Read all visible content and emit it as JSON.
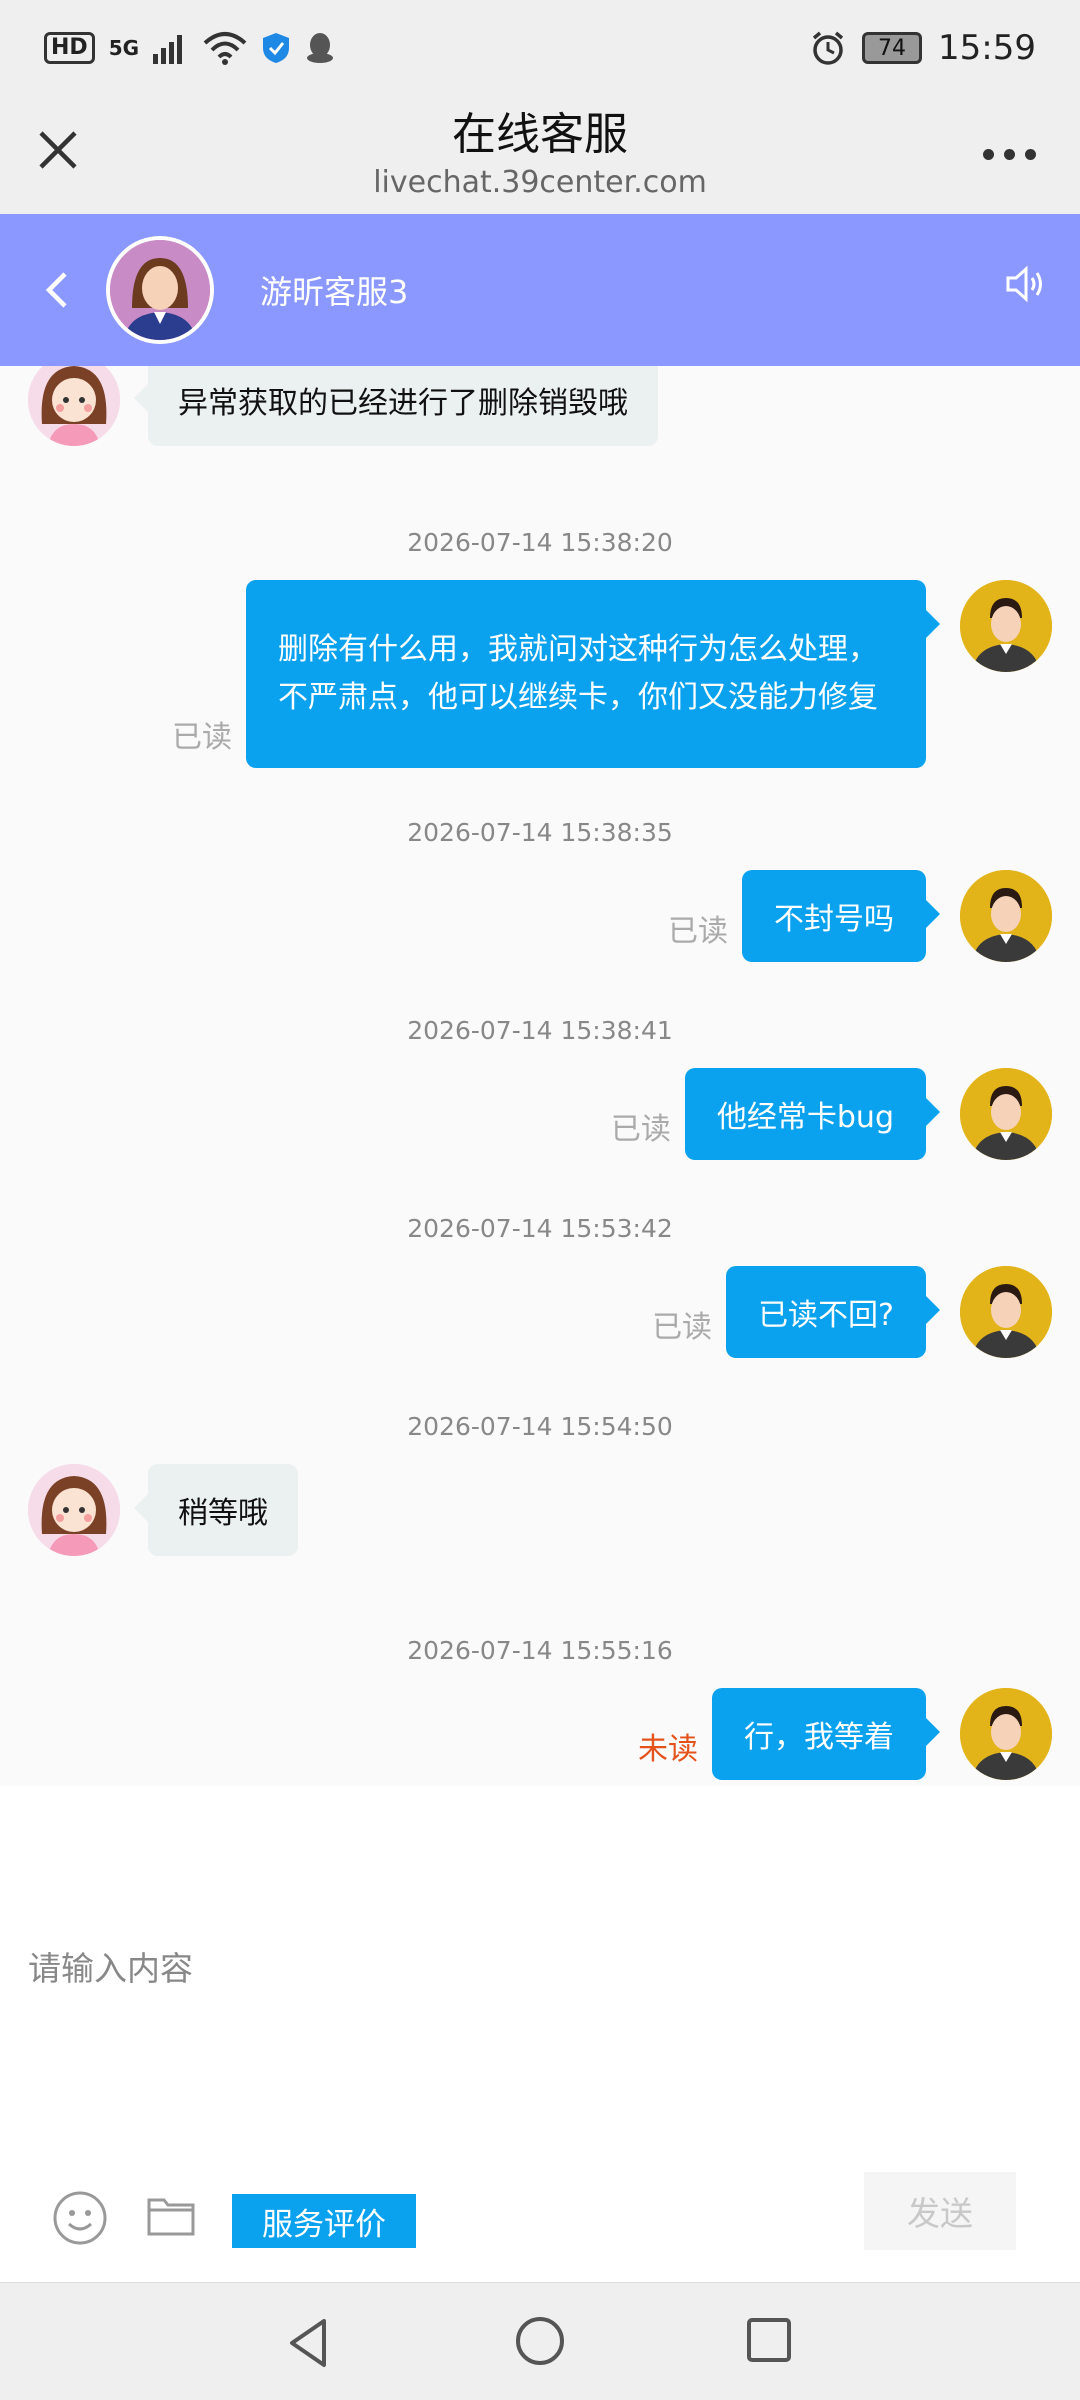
{
  "status_bar": {
    "hd": "HD",
    "network": "5G",
    "battery": "74",
    "time": "15:59"
  },
  "header": {
    "title": "在线客服",
    "url": "livechat.39center.com"
  },
  "agent": {
    "name": "游昕客服3"
  },
  "messages": [
    {
      "side": "left",
      "text": "异常获取的已经进行了删除销毁哦"
    },
    {
      "timestamp": "2026-07-14 15:38:20",
      "side": "right",
      "text": "删除有什么用，我就问对这种行为怎么处理，不严肃点，他可以继续卡，你们又没能力修复",
      "status": "已读"
    },
    {
      "timestamp": "2026-07-14 15:38:35",
      "side": "right",
      "text": "不封号吗",
      "status": "已读"
    },
    {
      "timestamp": "2026-07-14 15:38:41",
      "side": "right",
      "text": "他经常卡bug",
      "status": "已读"
    },
    {
      "timestamp": "2026-07-14 15:53:42",
      "side": "right",
      "text": "已读不回?",
      "status": "已读"
    },
    {
      "timestamp": "2026-07-14 15:54:50",
      "side": "left",
      "text": "稍等哦"
    },
    {
      "timestamp": "2026-07-14 15:55:16",
      "side": "right",
      "text": "行，我等着",
      "status": "未读"
    }
  ],
  "input": {
    "placeholder": "请输入内容"
  },
  "toolbar": {
    "rate_label": "服务评价",
    "send_label": "发送"
  },
  "colors": {
    "accent": "#0aa2ee",
    "agent_bar": "#8b98ff",
    "unread": "#e5531c"
  }
}
